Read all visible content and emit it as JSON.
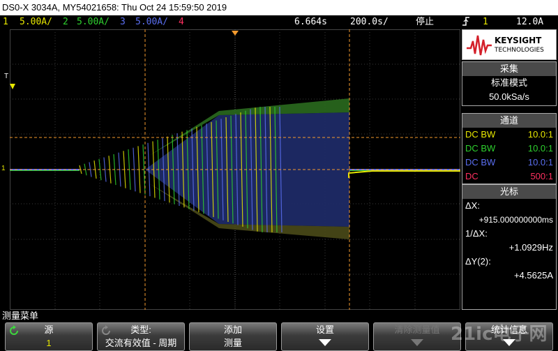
{
  "title": "DS0-X 3034A, MY54021658: Thu Oct 24 15:59:50 2019",
  "channels": [
    {
      "num": "1",
      "scale": "5.00A/",
      "color": "#e8e800"
    },
    {
      "num": "2",
      "scale": "5.00A/",
      "color": "#2ed02e"
    },
    {
      "num": "3",
      "scale": "5.00A/",
      "color": "#5a6ef0"
    },
    {
      "num": "4",
      "scale": "",
      "color": "#ff3060"
    }
  ],
  "timebase": {
    "delay": "6.664s",
    "scale": "200.0s/",
    "run_state": "停止"
  },
  "trigger": {
    "slope_icon": "trigger-edge-icon",
    "source": "1",
    "level": "12.0A"
  },
  "brand": {
    "name": "KEYSIGHT",
    "sub": "TECHNOLOGIES"
  },
  "acquisition": {
    "header": "采集",
    "mode": "标准模式",
    "rate": "50.0kSa/s"
  },
  "channel_panel": {
    "header": "通道",
    "rows": [
      {
        "coupling": "DC BW",
        "probe": "10.0:1",
        "color": "#e8e800"
      },
      {
        "coupling": "DC BW",
        "probe": "10.0:1",
        "color": "#2ed02e"
      },
      {
        "coupling": "DC BW",
        "probe": "10.0:1",
        "color": "#5a6ef0"
      },
      {
        "coupling": "DC",
        "probe": "500:1",
        "color": "#ff3060"
      }
    ]
  },
  "cursors": {
    "header": "光标",
    "dx_label": "ΔX:",
    "dx_value": "+915.000000000ms",
    "inv_dx_label": "1/ΔX:",
    "inv_dx_value": "+1.0929Hz",
    "dy_label": "ΔY(2):",
    "dy_value": "+4.5625A"
  },
  "graticule": {
    "trigger_marker": "T",
    "ground_marker": "1"
  },
  "menu": {
    "title": "测量菜单",
    "keys": [
      {
        "line1": "源",
        "line2": "1",
        "icon": "rotate-knob-icon",
        "enabled": true
      },
      {
        "line1": "类型:",
        "line2": "交流有效值 - 周期",
        "icon": "rotate-knob-icon",
        "enabled": true
      },
      {
        "line1": "添加",
        "line2": "测量",
        "enabled": true
      },
      {
        "line1": "设置",
        "line2": "",
        "arrow": true,
        "enabled": true
      },
      {
        "line1": "清除测量值",
        "line2": "",
        "arrow": true,
        "enabled": false
      },
      {
        "line1": "统计信息",
        "line2": "",
        "arrow": true,
        "enabled": true
      }
    ]
  },
  "watermark": "21ic电子网"
}
